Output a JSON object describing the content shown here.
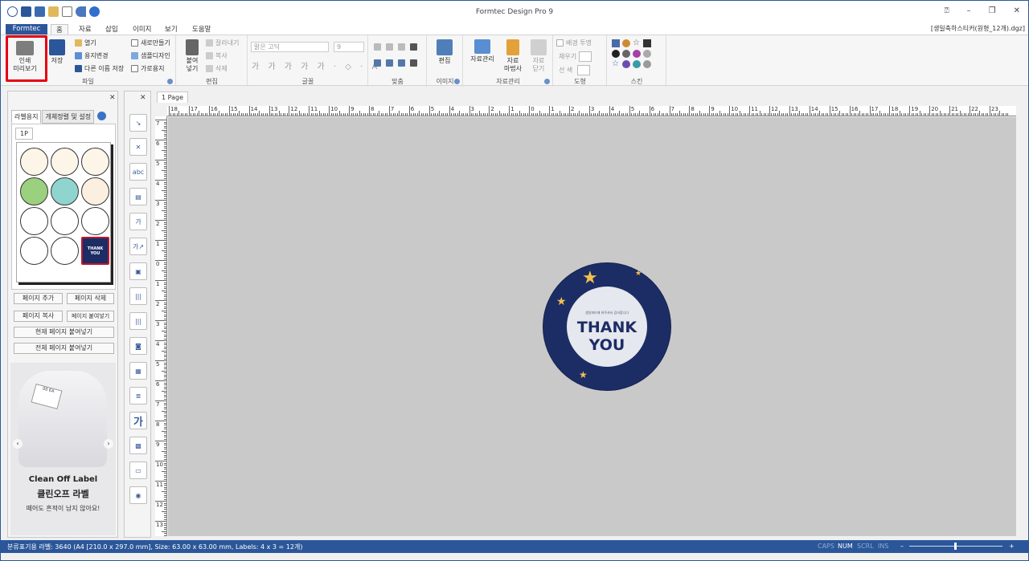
{
  "window": {
    "title": "Formtec Design Pro 9",
    "file_name": "[생일축하스티커(원형_12개).dgz]"
  },
  "menu": {
    "items": [
      "Formtec",
      "홈",
      "자료",
      "삽입",
      "이미지",
      "보기",
      "도움말"
    ],
    "active": "홈"
  },
  "ribbon": {
    "file": {
      "print_preview_l1": "인쇄",
      "print_preview_l2": "미리보기",
      "save": "저장",
      "open": "열기",
      "change_paper": "용지변경",
      "save_as": "다른 이름 저장",
      "new": "새로만들기",
      "sample_design": "샘플디자인",
      "landscape": "가로용지",
      "label": "파일"
    },
    "edit": {
      "paste_l1": "붙여",
      "paste_l2": "넣기",
      "cut": "잘라내기",
      "copy": "복사",
      "delete": "삭제",
      "label": "편집"
    },
    "font": {
      "font_name": "맑은 고딕",
      "font_size": "9",
      "label": "글꼴"
    },
    "align": {
      "label": "맞춤"
    },
    "image": {
      "edit": "편집",
      "label": "이미지"
    },
    "data": {
      "data_manage": "자료관리",
      "wizard_l1": "자료",
      "wizard_l2": "마법사",
      "close_l1": "자료",
      "close_l2": "닫기",
      "label": "자료관리"
    },
    "shape": {
      "transparent_bg": "배경 투명",
      "fill": "채우기",
      "line": "선  색",
      "label": "도형"
    },
    "skin": {
      "label": "스킨"
    }
  },
  "left_panel": {
    "tab_label_paper": "라벨용지",
    "tab_object_align": "개체정렬 및 설정",
    "page_tab": "1P",
    "add_page": "페이지 추가",
    "delete_page": "페이지 삭제",
    "copy_page": "페이지 복사",
    "paste_page": "페이지 붙여넣기",
    "paste_current": "현재 페이지 붙여넣기",
    "paste_all": "전체 페이지 붙여넣기",
    "ad": {
      "line1": "Clean Off Label",
      "line2": "클린오프 라벨",
      "line3": "떼어도 흔적이 남지 않아요!",
      "tag": "00 EA"
    }
  },
  "document": {
    "tab": "1 Page",
    "sticker": {
      "line1": "THANK",
      "line2": "YOU",
      "small": "생일파티에 와주셔서 감사합니다"
    },
    "ruler_top": [
      "18",
      "17",
      "16",
      "15",
      "14",
      "13",
      "12",
      "11",
      "10",
      "9",
      "8",
      "7",
      "6",
      "5",
      "4",
      "3",
      "2",
      "1",
      "0",
      "1",
      "2",
      "3",
      "4",
      "5",
      "6",
      "7",
      "8",
      "9",
      "10",
      "11",
      "12",
      "13",
      "14",
      "15",
      "16",
      "17",
      "18",
      "19",
      "20",
      "21",
      "22",
      "23"
    ],
    "ruler_left": [
      "7",
      "6",
      "5",
      "4",
      "3",
      "2",
      "1",
      "0",
      "1",
      "2",
      "3",
      "4",
      "5",
      "6",
      "7",
      "8",
      "9",
      "10",
      "11",
      "12",
      "13"
    ]
  },
  "statusbar": {
    "info": "분류표기용 라벨: 3640 (A4 [210.0 x 297.0 mm], Size: 63.00 x 63.00 mm,  Labels: 4 x 3 = 12개)",
    "caps": "CAPS",
    "num": "NUM",
    "scrl": "SCRL",
    "ins": "INS"
  },
  "colors": {
    "accent": "#2b579a",
    "highlight": "#e60012",
    "sticker_bg": "#1c2d66"
  }
}
